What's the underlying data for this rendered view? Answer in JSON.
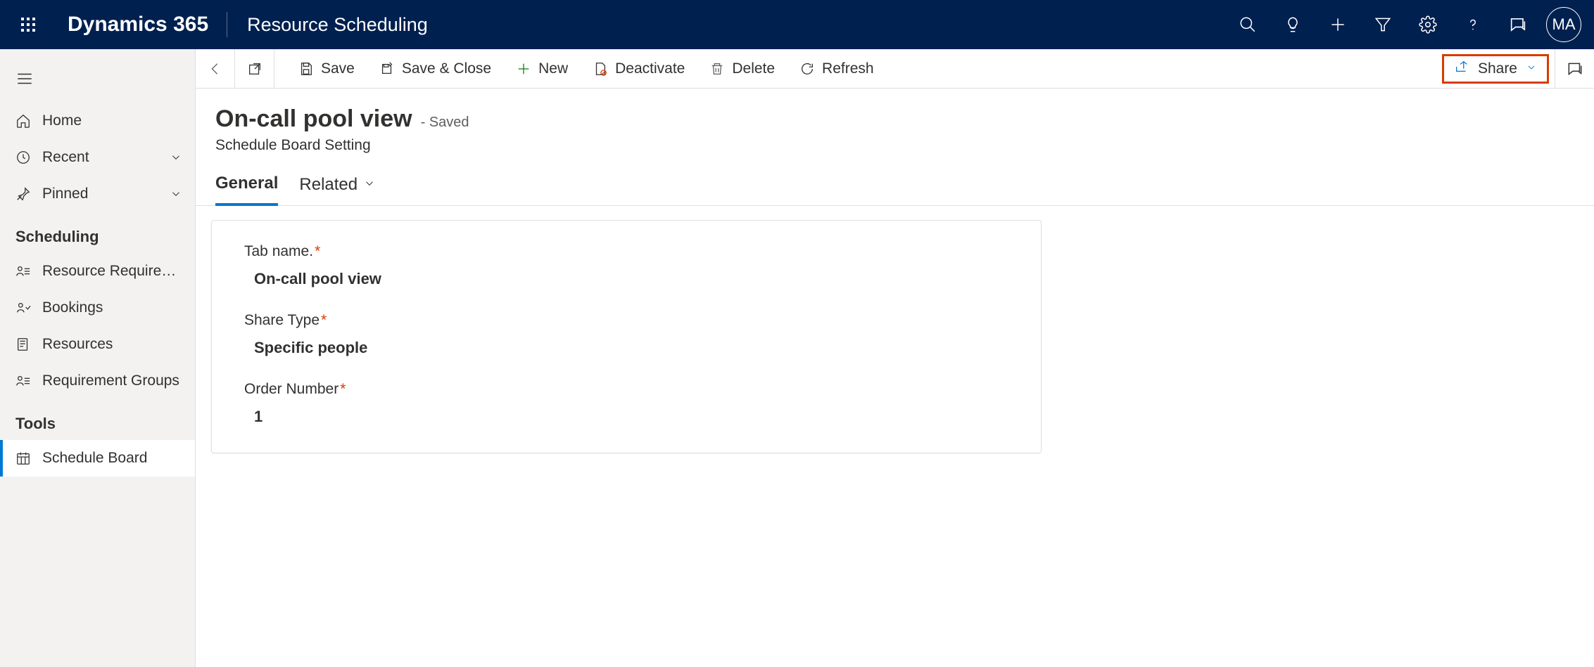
{
  "topbar": {
    "brand": "Dynamics 365",
    "appname": "Resource Scheduling",
    "avatar_initials": "MA"
  },
  "sidebar": {
    "home": "Home",
    "recent": "Recent",
    "pinned": "Pinned",
    "section_scheduling": "Scheduling",
    "resource_reqs": "Resource Requireme…",
    "bookings": "Bookings",
    "resources": "Resources",
    "req_groups": "Requirement Groups",
    "section_tools": "Tools",
    "schedule_board": "Schedule Board"
  },
  "cmdbar": {
    "save": "Save",
    "save_close": "Save & Close",
    "new": "New",
    "deactivate": "Deactivate",
    "delete": "Delete",
    "refresh": "Refresh",
    "share": "Share"
  },
  "header": {
    "title": "On-call pool view",
    "status": "- Saved",
    "subtitle": "Schedule Board Setting"
  },
  "tabs": {
    "general": "General",
    "related": "Related"
  },
  "form": {
    "tab_name_label": "Tab name.",
    "tab_name_value": "On-call pool view",
    "share_type_label": "Share Type",
    "share_type_value": "Specific people",
    "order_number_label": "Order Number",
    "order_number_value": "1"
  }
}
